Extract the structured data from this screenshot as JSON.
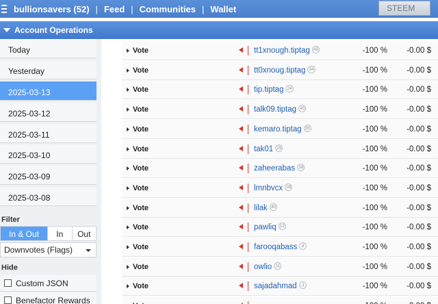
{
  "topbar": {
    "account": "bullionsavers (52)",
    "links": [
      "Feed",
      "Communities",
      "Wallet"
    ],
    "chain": "STEEM"
  },
  "section": {
    "title": "Account Operations"
  },
  "sidebar": {
    "days": [
      "Today",
      "Yesterday",
      "2025-03-13",
      "2025-03-12",
      "2025-03-11",
      "2025-03-10",
      "2025-03-09",
      "2025-03-08"
    ],
    "active_day_index": 2,
    "filter_label": "Filter",
    "filter_options": [
      "In & Out",
      "In",
      "Out"
    ],
    "filter_selected": "In & Out",
    "op_select": "Downvotes (Flags)",
    "hide_label": "Hide",
    "hide_options": [
      "Custom JSON",
      "Benefactor Rewards"
    ]
  },
  "operations": [
    {
      "type": "Vote",
      "account": "tt1xnough.tiptag",
      "rep": "45",
      "percent": "-100 %",
      "amount": "-0.00 $"
    },
    {
      "type": "Vote",
      "account": "tt0xnoug.tiptag",
      "rep": "34",
      "percent": "-100 %",
      "amount": "-0.00 $"
    },
    {
      "type": "Vote",
      "account": "tip.tiptag",
      "rep": "24",
      "percent": "-100 %",
      "amount": "-0.00 $"
    },
    {
      "type": "Vote",
      "account": "talk09.tiptag",
      "rep": "45",
      "percent": "-100 %",
      "amount": "-0.00 $"
    },
    {
      "type": "Vote",
      "account": "kemaro.tiptag",
      "rep": "35",
      "percent": "-100 %",
      "amount": "-0.00 $"
    },
    {
      "type": "Vote",
      "account": "tak01",
      "rep": "25",
      "percent": "-100 %",
      "amount": "-0.00 $"
    },
    {
      "type": "Vote",
      "account": "zaheerabas",
      "rep": "38",
      "percent": "-100 %",
      "amount": "-0.00 $"
    },
    {
      "type": "Vote",
      "account": "lmnbvcx",
      "rep": "39",
      "percent": "-100 %",
      "amount": "-0.00 $"
    },
    {
      "type": "Vote",
      "account": "lilak",
      "rep": "40",
      "percent": "-100 %",
      "amount": "-0.00 $"
    },
    {
      "type": "Vote",
      "account": "pawliq",
      "rep": "12",
      "percent": "-100 %",
      "amount": "-0.00 $"
    },
    {
      "type": "Vote",
      "account": "farooqabass",
      "rep": "8",
      "percent": "-100 %",
      "amount": "-0.00 $"
    },
    {
      "type": "Vote",
      "account": "owlio",
      "rep": "11",
      "percent": "-100 %",
      "amount": "-0.00 $"
    },
    {
      "type": "Vote",
      "account": "sajadahmad",
      "rep": "-1",
      "percent": "-100 %",
      "amount": "-0.00 $"
    },
    {
      "type": "Vote",
      "account": "",
      "rep": "",
      "percent": "-100 %",
      "amount": "-0.00 $"
    }
  ],
  "colors": {
    "accent": "#5aa1f5",
    "header": "#4a7fcc",
    "flag": "#d9342b",
    "link": "#1f5fb4"
  },
  "icons": {
    "flag": "downvote-flag-icon",
    "expand": "expand-arrow-icon",
    "menu": "hamburger-icon"
  }
}
